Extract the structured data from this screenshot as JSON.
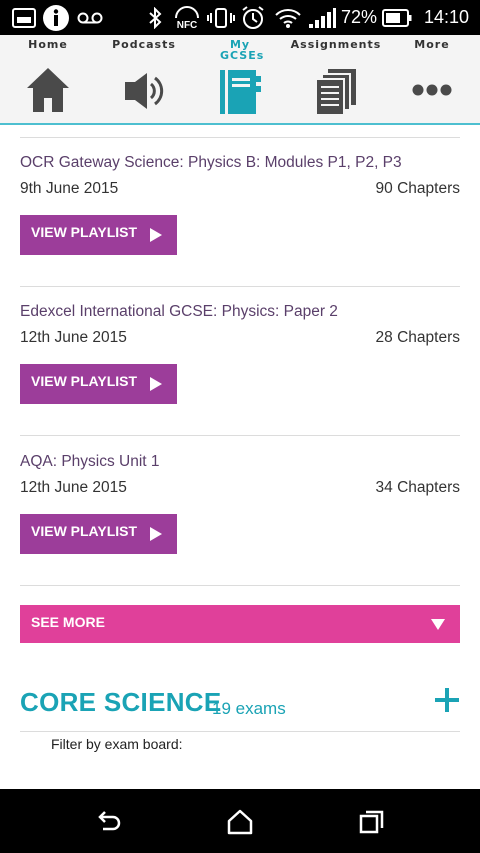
{
  "status_bar": {
    "battery_percent": "72%",
    "time": "14:10",
    "icons": [
      "gallery-icon",
      "info-icon",
      "voicemail-icon",
      "bluetooth-icon",
      "nfc-icon",
      "vibrate-icon",
      "alarm-icon",
      "wifi-icon",
      "signal-icon",
      "battery-icon"
    ]
  },
  "nav": {
    "items": [
      {
        "label": "Home",
        "icon": "home-icon"
      },
      {
        "label": "Podcasts",
        "icon": "speaker-icon"
      },
      {
        "label": "My GCSEs",
        "icon": "notebook-icon",
        "active": true
      },
      {
        "label": "Assignments",
        "icon": "documents-icon"
      },
      {
        "label": "More",
        "icon": "more-dots-icon"
      }
    ],
    "active_color": "#1aa3b5",
    "accent_border": "#4dbfd0"
  },
  "exams": [
    {
      "title": "OCR Gateway Science: Physics B: Modules P1, P2, P3",
      "date": "9th June 2015",
      "chapters": "90 Chapters",
      "button": "VIEW PLAYLIST"
    },
    {
      "title": "Edexcel International GCSE: Physics: Paper 2",
      "date": "12th June 2015",
      "chapters": "28 Chapters",
      "button": "VIEW PLAYLIST"
    },
    {
      "title": "AQA: Physics Unit 1",
      "date": "12th June 2015",
      "chapters": "34 Chapters",
      "button": "VIEW PLAYLIST"
    }
  ],
  "see_more": {
    "label": "SEE MORE",
    "color": "#e0409a"
  },
  "playlist_button_color": "#9c3d9a",
  "core_science": {
    "title": "CORE SCIENCE",
    "count": "19 exams",
    "filter_label": "Filter by exam board:",
    "color": "#1aa3b5"
  },
  "system_nav": {
    "icons": [
      "back-icon",
      "home-outline-icon",
      "recents-icon"
    ]
  }
}
